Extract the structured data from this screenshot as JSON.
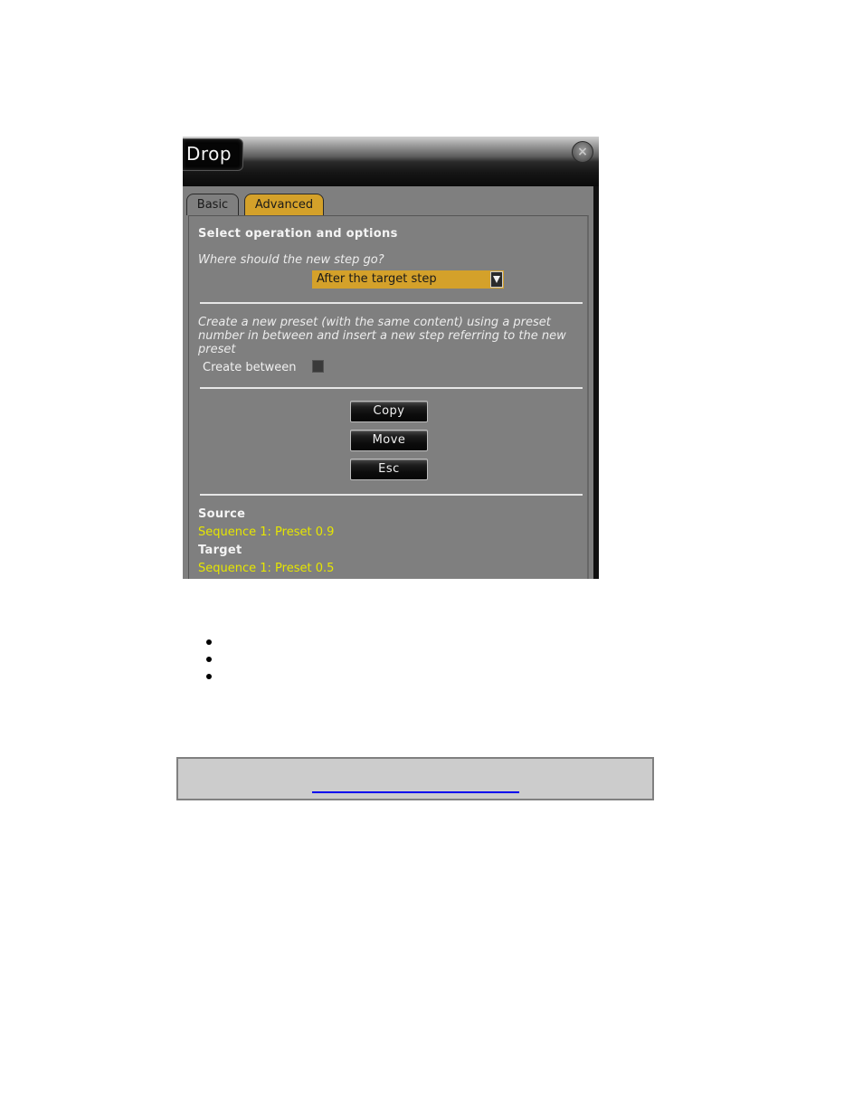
{
  "dialog": {
    "title": "Drop",
    "close_icon": "close-icon",
    "tabs": [
      {
        "label": "Basic",
        "active": false
      },
      {
        "label": "Advanced",
        "active": true
      }
    ],
    "section_heading": "Select operation and options",
    "position_question": "Where should the new step go?",
    "position_select": {
      "selected": "After the target step",
      "arrow_icon": "chevron-down-icon"
    },
    "create_between_description": "Create a new preset (with the same content) using a preset number in between and insert a new step referring to the new preset",
    "create_between": {
      "label": "Create between",
      "checked": false
    },
    "buttons": {
      "copy": "Copy",
      "move": "Move",
      "esc": "Esc"
    },
    "source": {
      "heading": "Source",
      "value": "Sequence 1: Preset 0.9"
    },
    "target": {
      "heading": "Target",
      "value": "Sequence 1: Preset 0.5"
    }
  },
  "colors": {
    "accent": "#d4a12a",
    "panel_bg": "#7f7f7f",
    "highlight_text": "#e6e600",
    "link": "#0000ee"
  },
  "page": {
    "bullet_count": 3,
    "link_box": {
      "link_text": ""
    }
  }
}
